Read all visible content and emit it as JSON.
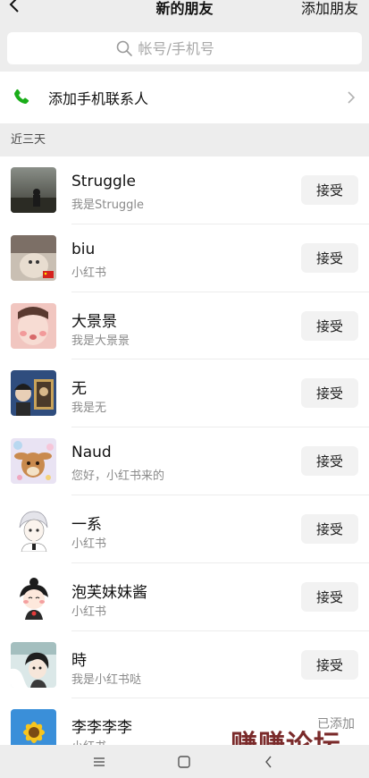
{
  "header": {
    "title": "新的朋友",
    "action_label": "添加朋友"
  },
  "search": {
    "placeholder": "帐号/手机号"
  },
  "add_contacts": {
    "label": "添加手机联系人"
  },
  "section": {
    "title": "近三天"
  },
  "requests": [
    {
      "name": "Struggle",
      "message": "我是Struggle",
      "action": "接受",
      "avatar": "avatar-struggle"
    },
    {
      "name": "biu",
      "message": "小红书",
      "action": "接受",
      "avatar": "avatar-biu"
    },
    {
      "name": "大景景",
      "message": "我是大景景",
      "action": "接受",
      "avatar": "avatar-dajingjing"
    },
    {
      "name": "无",
      "message": "我是无",
      "action": "接受",
      "avatar": "avatar-wu"
    },
    {
      "name": "Naud",
      "message": "您好，小红书来的",
      "action": "接受",
      "avatar": "avatar-naud"
    },
    {
      "name": "一系",
      "message": "小红书",
      "action": "接受",
      "avatar": "avatar-yixi"
    },
    {
      "name": "泡芙妹妹酱",
      "message": "小红书",
      "action": "接受",
      "avatar": "avatar-paofu"
    },
    {
      "name": "時",
      "message": "我是小红书哒",
      "action": "接受",
      "avatar": "avatar-shi"
    },
    {
      "name": "李李李李",
      "message": "小红书",
      "status": "已添加",
      "avatar": "avatar-lili"
    }
  ],
  "watermark": "赚赚论坛",
  "colors": {
    "background": "#ededed",
    "phone_icon": "#1aad19",
    "watermark": "#7a2a2a"
  },
  "icons": {
    "back": "chevron-left-icon",
    "search": "search-icon",
    "phone": "phone-icon",
    "chevron": "chevron-right-icon",
    "nav_menu": "menu-icon",
    "nav_home": "home-icon",
    "nav_back": "back-icon"
  }
}
